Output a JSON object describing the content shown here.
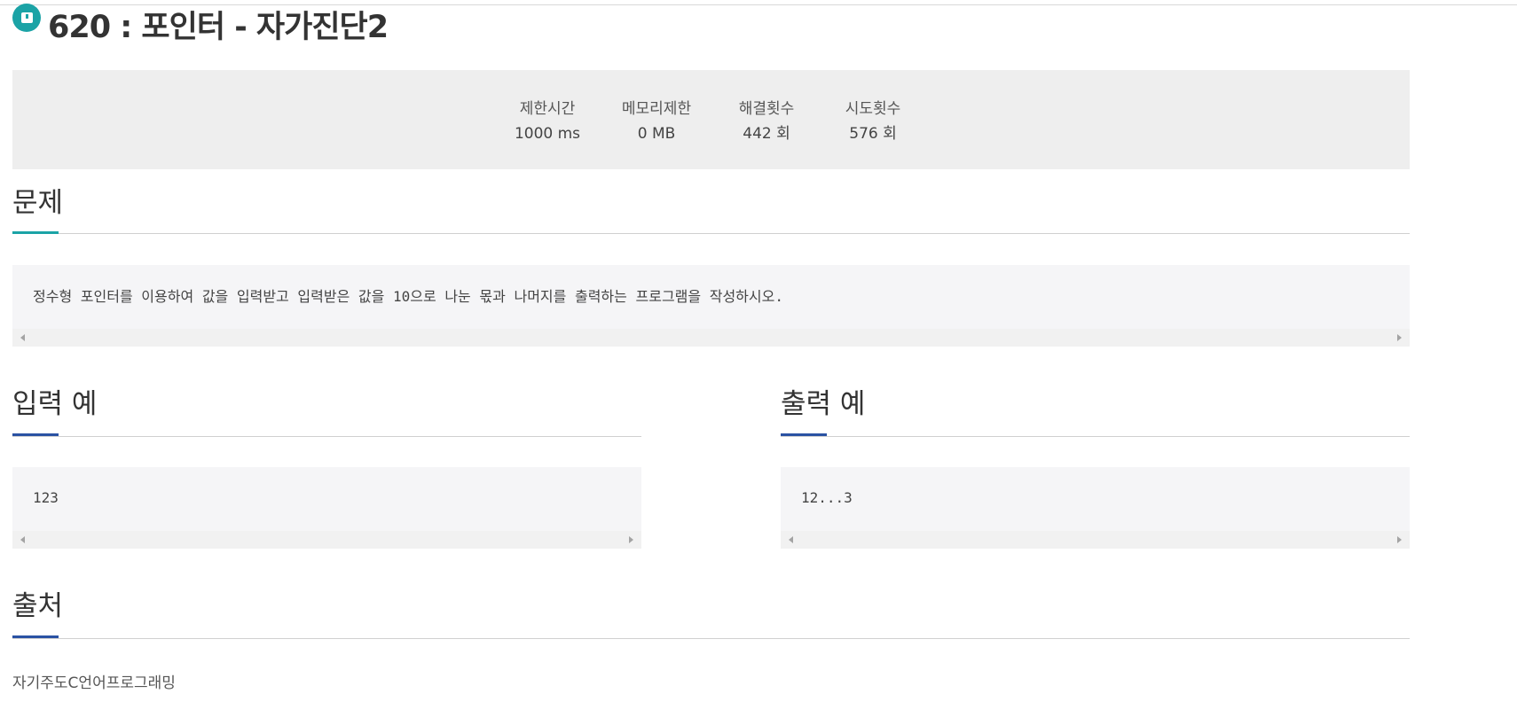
{
  "problem": {
    "title": "620 : 포인터 - 자가진단2"
  },
  "stats": [
    {
      "label": "제한시간",
      "value": "1000 ms"
    },
    {
      "label": "메모리제한",
      "value": "0 MB"
    },
    {
      "label": "해결횟수",
      "value": "442 회"
    },
    {
      "label": "시도횟수",
      "value": "576 회"
    }
  ],
  "sections": {
    "problem_heading": "문제",
    "problem_text": "정수형 포인터를 이용하여 값을 입력받고 입력받은 값을 10으로 나눈 몫과 나머지를 출력하는 프로그램을 작성하시오.",
    "input_heading": "입력 예",
    "input_example": "123",
    "output_heading": "출력 예",
    "output_example": "12...3",
    "source_heading": "출처",
    "source_text": "자기주도C언어프로그래밍"
  },
  "colors": {
    "accent_teal": "#1ba3a6",
    "accent_blue": "#2a52a3"
  },
  "icons": {
    "title_icon": "bookmark-icon",
    "scroll_left": "scroll-left-arrow-icon",
    "scroll_right": "scroll-right-arrow-icon"
  }
}
